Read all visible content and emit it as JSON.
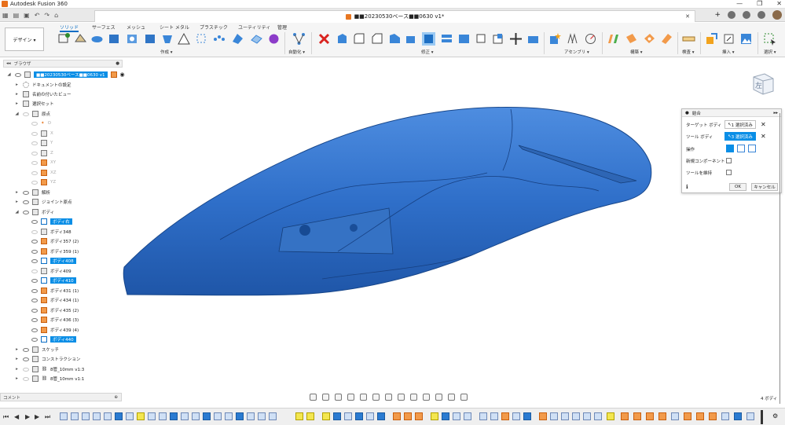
{
  "window": {
    "title": "Autodesk Fusion 360",
    "controls": [
      "—",
      "❐",
      "✕"
    ]
  },
  "doc_tab": {
    "title": "■■20230530ベース■■0630 v1*",
    "close": "✕"
  },
  "ribbon": {
    "workspace": "デザイン ▾",
    "tabs": [
      "ソリッド",
      "サーフェス",
      "メッシュ",
      "シート メタル",
      "プラスチック",
      "ユーティリティ",
      "管理"
    ],
    "groups": [
      "作成 ▾",
      "自動化 ▾",
      "修正 ▾",
      "アセンブリ ▾",
      "構築 ▾",
      "検査 ▾",
      "挿入 ▾",
      "選択 ▾"
    ]
  },
  "browser": {
    "header": "ブラウザ",
    "items": [
      {
        "label": "■■20230530ベース■■0630 v1"
      },
      {
        "label": "ドキュメントの設定"
      },
      {
        "label": "名前の付いたビュー"
      },
      {
        "label": "選択セット"
      },
      {
        "label": "原点"
      },
      {
        "label": "O"
      },
      {
        "label": "X"
      },
      {
        "label": "Y"
      },
      {
        "label": "Z"
      },
      {
        "label": "XY"
      },
      {
        "label": "XZ"
      },
      {
        "label": "YZ"
      },
      {
        "label": "解析"
      },
      {
        "label": "ジョイント原点"
      },
      {
        "label": "ボディ"
      },
      {
        "label": "ボディ右"
      },
      {
        "label": "ボディ348"
      },
      {
        "label": "ボディ357 (2)"
      },
      {
        "label": "ボディ359 (1)"
      },
      {
        "label": "ボディ408"
      },
      {
        "label": "ボディ409"
      },
      {
        "label": "ボディ410"
      },
      {
        "label": "ボディ431 (1)"
      },
      {
        "label": "ボディ434 (1)"
      },
      {
        "label": "ボディ435 (2)"
      },
      {
        "label": "ボディ436 (3)"
      },
      {
        "label": "ボディ439 (4)"
      },
      {
        "label": "ボディ440"
      },
      {
        "label": "スケッチ"
      },
      {
        "label": "コンストラクション"
      },
      {
        "label": "8管_10mm v1:3"
      },
      {
        "label": "8管_10mm v1:1"
      }
    ]
  },
  "dialog": {
    "title": "結合",
    "target_label": "ターゲット ボディ",
    "target_value": "1 選択済み",
    "tool_label": "ツール ボディ",
    "tool_value": "3 選択済み",
    "operation_label": "操作",
    "new_component_label": "新規コンポーネント",
    "keep_tools_label": "ツールを維持",
    "ok": "OK",
    "cancel": "キャンセル"
  },
  "viewcube_face": "左",
  "comment_label": "コメント",
  "status_right": "4 ボディ",
  "colors": {
    "accent": "#0a8ee6",
    "model": "#2f6fc9"
  }
}
